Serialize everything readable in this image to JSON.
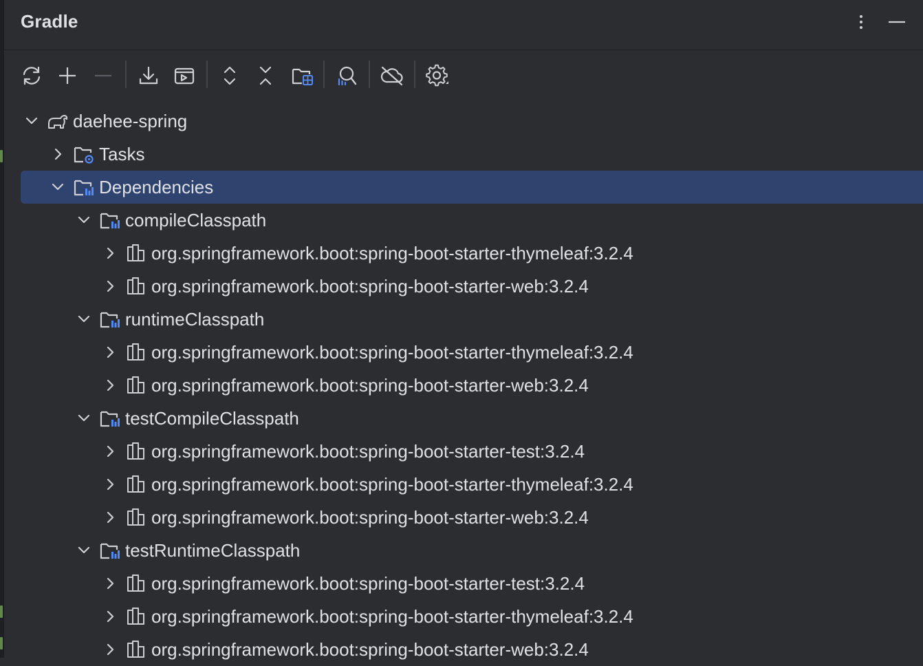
{
  "panel": {
    "title": "Gradle"
  },
  "header_icons": [
    "more-vertical-icon",
    "minimize-icon"
  ],
  "toolbar": {
    "buttons": [
      "reload-icon",
      "add-icon",
      "remove-icon",
      "download-sources-icon",
      "execute-task-icon",
      "expand-all-icon",
      "collapse-all-icon",
      "group-modules-icon",
      "analyze-dependencies-icon",
      "offline-mode-icon",
      "settings-icon"
    ]
  },
  "tree": {
    "project": "daehee-spring",
    "tasks": "Tasks",
    "dependencies": "Dependencies",
    "configurations": [
      {
        "name": "compileClasspath",
        "deps": [
          "org.springframework.boot:spring-boot-starter-thymeleaf:3.2.4",
          "org.springframework.boot:spring-boot-starter-web:3.2.4"
        ]
      },
      {
        "name": "runtimeClasspath",
        "deps": [
          "org.springframework.boot:spring-boot-starter-thymeleaf:3.2.4",
          "org.springframework.boot:spring-boot-starter-web:3.2.4"
        ]
      },
      {
        "name": "testCompileClasspath",
        "deps": [
          "org.springframework.boot:spring-boot-starter-test:3.2.4",
          "org.springframework.boot:spring-boot-starter-thymeleaf:3.2.4",
          "org.springframework.boot:spring-boot-starter-web:3.2.4"
        ]
      },
      {
        "name": "testRuntimeClasspath",
        "deps": [
          "org.springframework.boot:spring-boot-starter-test:3.2.4",
          "org.springframework.boot:spring-boot-starter-thymeleaf:3.2.4",
          "org.springframework.boot:spring-boot-starter-web:3.2.4"
        ]
      }
    ]
  },
  "colors": {
    "background": "#2b2d30",
    "selection": "#2e436e",
    "text": "#dfe1e5",
    "icon": "#ced0d6",
    "accent_blue": "#548af7"
  }
}
